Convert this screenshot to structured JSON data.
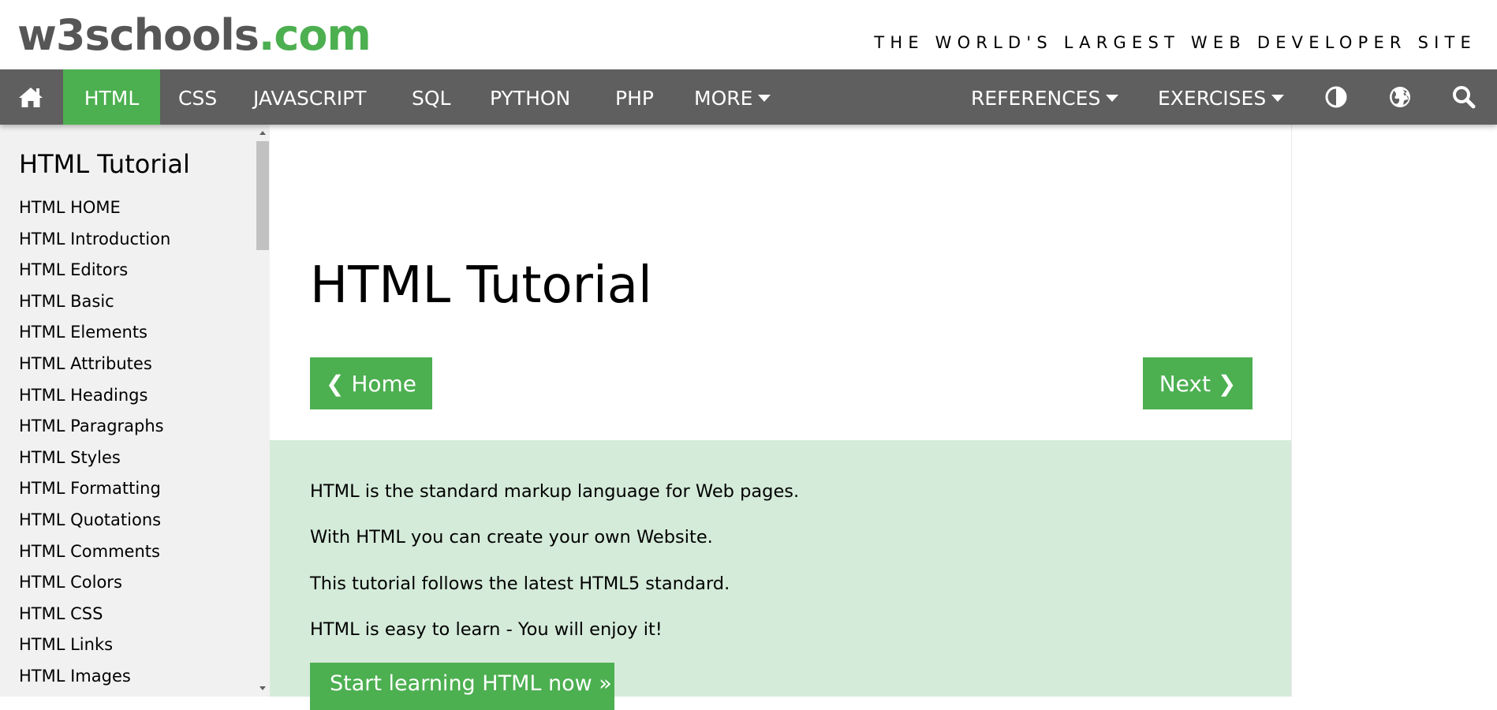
{
  "header": {
    "logo_main": "w3schools",
    "logo_tld": ".com",
    "tagline": "THE WORLD'S LARGEST WEB DEVELOPER SITE"
  },
  "nav": {
    "items": [
      {
        "label": "HTML",
        "active": true
      },
      {
        "label": "CSS"
      },
      {
        "label": "JAVASCRIPT"
      },
      {
        "label": "SQL"
      },
      {
        "label": "PYTHON"
      },
      {
        "label": "PHP"
      },
      {
        "label": "MORE",
        "dropdown": true
      },
      {
        "label": "REFERENCES",
        "dropdown": true
      },
      {
        "label": "EXERCISES",
        "dropdown": true
      }
    ],
    "icons": [
      "home-icon",
      "contrast-icon",
      "globe-icon",
      "search-icon"
    ]
  },
  "sidebar": {
    "title": "HTML Tutorial",
    "items": [
      "HTML HOME",
      "HTML Introduction",
      "HTML Editors",
      "HTML Basic",
      "HTML Elements",
      "HTML Attributes",
      "HTML Headings",
      "HTML Paragraphs",
      "HTML Styles",
      "HTML Formatting",
      "HTML Quotations",
      "HTML Comments",
      "HTML Colors",
      "HTML CSS",
      "HTML Links",
      "HTML Images"
    ]
  },
  "main": {
    "title": "HTML Tutorial",
    "home_button": "❮ Home",
    "next_button": "Next ❯",
    "intro": [
      "HTML is the standard markup language for Web pages.",
      "With HTML you can create your own Website.",
      "This tutorial follows the latest HTML5 standard.",
      "HTML is easy to learn - You will enjoy it!"
    ],
    "start_button": "Start learning HTML now »"
  },
  "colors": {
    "brand_green": "#4caf50",
    "nav_bg": "#5f5f5f",
    "sidebar_bg": "#f1f1f1",
    "intro_bg": "#d4ebd9",
    "logo_gray": "#565656"
  }
}
